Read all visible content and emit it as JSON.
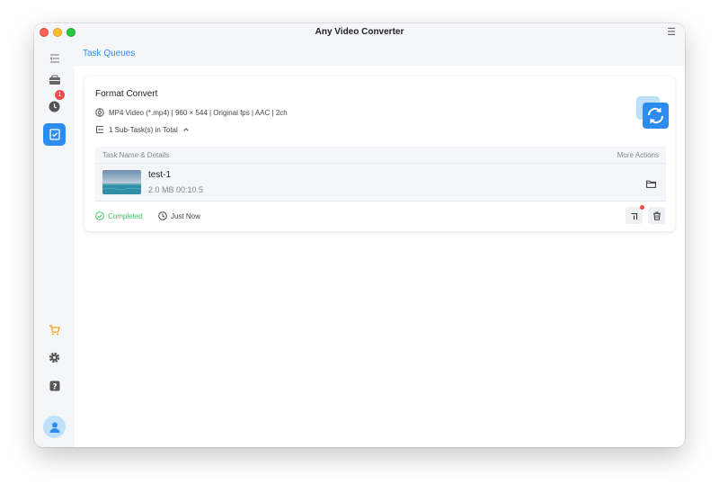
{
  "window": {
    "title": "Any Video Converter"
  },
  "sidebar": {
    "items": [
      {
        "icon": "sidebar-toggle-icon"
      },
      {
        "icon": "toolbox-icon"
      },
      {
        "icon": "history-icon",
        "badge": "1"
      },
      {
        "icon": "task-queue-icon",
        "active": true
      },
      {
        "icon": "cart-icon"
      },
      {
        "icon": "gear-icon"
      },
      {
        "icon": "help-icon"
      }
    ],
    "accent": "#2d8cf0"
  },
  "page": {
    "title": "Task Queues"
  },
  "card": {
    "title": "Format Convert",
    "format_info": "MP4 Video (*.mp4) | 960 × 544 | Original fps | AAC | 2ch",
    "subtasks_label": "1 Sub-Task(s) in Total",
    "table": {
      "col_name": "Task Name & Details",
      "col_actions": "More Actions"
    },
    "task": {
      "name": "test-1",
      "details": "2.0 MB 00:10.5"
    },
    "status": "Completed",
    "time": "Just Now"
  },
  "colors": {
    "success": "#3cc36b",
    "danger": "#f04a4a"
  }
}
